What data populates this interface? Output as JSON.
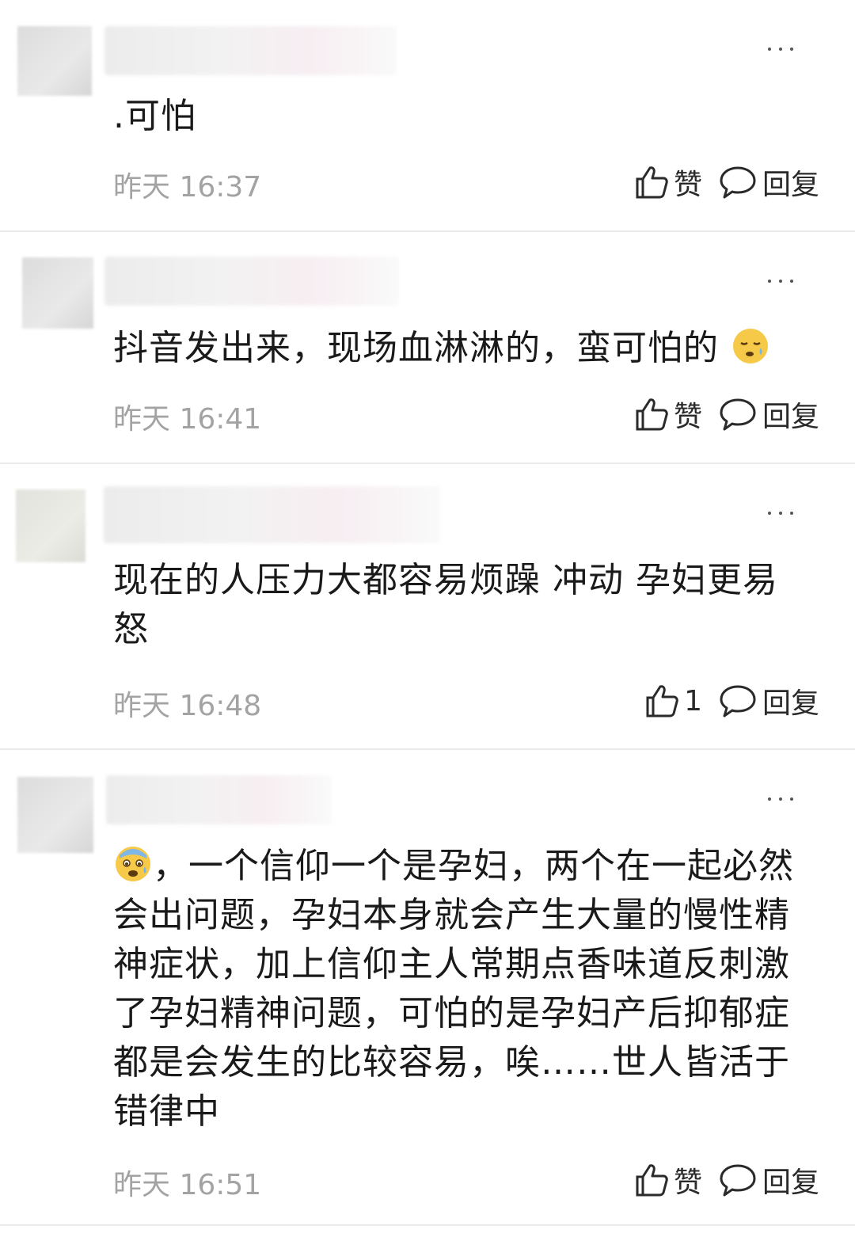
{
  "comments": [
    {
      "text": ".可怕",
      "time": "昨天 16:37",
      "like_label": "赞",
      "reply_label": "回复"
    },
    {
      "text": "抖音发出来，现场血淋淋的，蛮可怕的",
      "emoji": "sleepy-sweat-emoji",
      "time": "昨天 16:41",
      "like_label": "赞",
      "reply_label": "回复"
    },
    {
      "text_line1": "现在的人压力大都容易烦躁 冲动 孕妇更易",
      "text_line2": "怒",
      "time": "昨天 16:48",
      "like_label": "1",
      "reply_label": "回复"
    },
    {
      "emoji": "fearful-sweat-emoji",
      "line1": "，一个信仰一个是孕妇，两个在一起必然",
      "line2": "会出问题，孕妇本身就会产生大量的慢性精",
      "line3": "神症状，加上信仰主人常期点香味道反刺激",
      "line4": "了孕妇精神问题，可怕的是孕妇产后抑郁症",
      "line5": "都是会发生的比较容易，唉……世人皆活于",
      "line6": "错律中",
      "time": "昨天 16:51",
      "like_label": "赞",
      "reply_label": "回复"
    }
  ],
  "icons": {
    "like": "thumbs-up-icon",
    "reply": "speech-bubble-icon",
    "more": "more-dots-icon"
  }
}
